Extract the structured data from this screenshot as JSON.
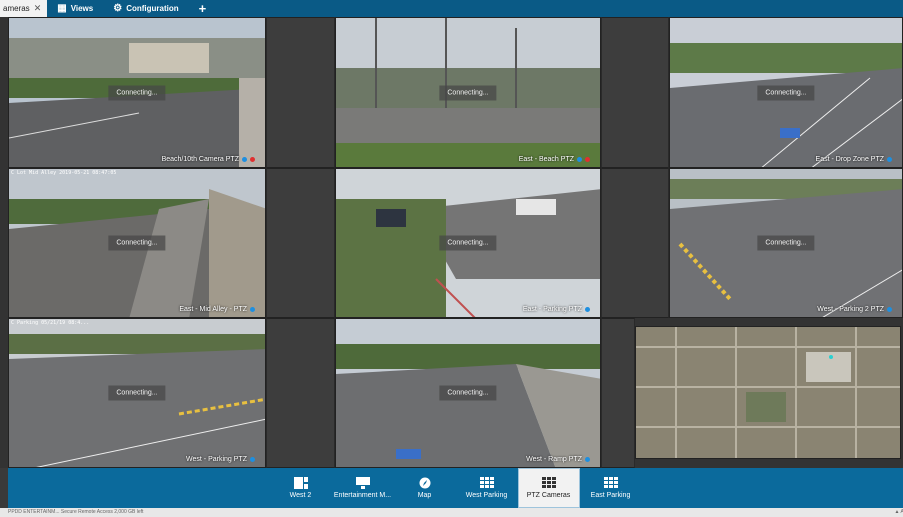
{
  "tabs": {
    "cameras_label": "ameras",
    "close_glyph": "✕",
    "views_label": "Views",
    "configuration_label": "Configuration",
    "add_glyph": "+"
  },
  "tiles": [
    {
      "label": "Beach/10th Camera PTZ",
      "status": "Connecting...",
      "dots": [
        "blue",
        "red"
      ]
    },
    {
      "label": "East - Beach PTZ",
      "status": "Connecting...",
      "dots": [
        "blue",
        "red"
      ]
    },
    {
      "label": "East - Drop Zone PTZ",
      "status": "Connecting...",
      "dots": [
        "blue"
      ]
    },
    {
      "label": "East - Mid Alley - PTZ",
      "status": "Connecting...",
      "dots": [
        "blue"
      ],
      "osd": "C Lot Mid Alley 2019-05-21 08:47:05"
    },
    {
      "label": "East - Parking PTZ",
      "status": "Connecting...",
      "dots": [
        "blue"
      ]
    },
    {
      "label": "West - Parking 2 PTZ",
      "status": "Connecting...",
      "dots": [
        "blue"
      ]
    },
    {
      "label": "West - Parking PTZ",
      "status": "Connecting...",
      "dots": [
        "blue"
      ],
      "osd": "C Parking 05/21/19 08:4..."
    },
    {
      "label": "West - Ramp PTZ",
      "status": "Connecting...",
      "dots": [
        "blue"
      ]
    }
  ],
  "dock": {
    "items": [
      {
        "label": "West 2",
        "icon": "layout-icon"
      },
      {
        "label": "Entertainment M...",
        "icon": "monitor-icon"
      },
      {
        "label": "Map",
        "icon": "compass-icon"
      },
      {
        "label": "West Parking",
        "icon": "grid-icon"
      },
      {
        "label": "PTZ Cameras",
        "icon": "grid-icon",
        "active": true
      },
      {
        "label": "East Parking",
        "icon": "grid-icon"
      }
    ]
  },
  "status": {
    "left": "PPDD ENTERTAINM...  Secure Remote Access 2,000 GB left",
    "right": "▲  Al"
  },
  "colors": {
    "topbar": "#0a5a86",
    "dock": "#0b6a9c",
    "dot_blue": "#1e8fe0",
    "dot_red": "#e03030"
  }
}
